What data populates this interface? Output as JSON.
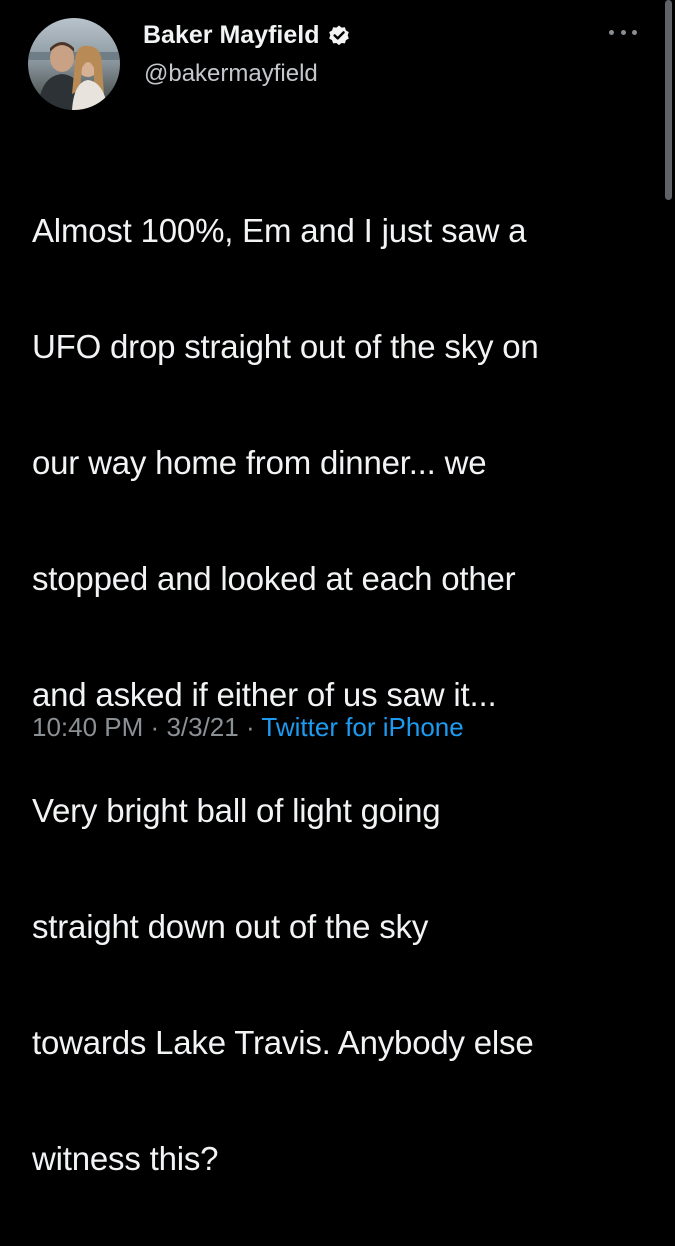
{
  "tweet": {
    "author": {
      "display_name": "Baker Mayfield",
      "handle": "@bakermayfield",
      "verified": true
    },
    "text_lines": [
      "Almost 100%, Em and I just saw a",
      "UFO drop straight out of the sky on",
      "our way home from dinner... we",
      "stopped and looked at each other",
      "and asked if either of us saw it...",
      "Very bright ball of light going",
      "straight down out of the sky",
      "towards Lake Travis. Anybody else",
      "witness this?"
    ],
    "time": "10:40 PM",
    "separator": "·",
    "date": "3/3/21",
    "source": "Twitter for iPhone"
  },
  "icons": {
    "verified": "verified-badge-icon",
    "more": "more-options-icon"
  },
  "colors": {
    "background": "#000000",
    "text": "#f2f3f5",
    "secondary_text": "#8b9095",
    "link": "#1d9bf0"
  }
}
